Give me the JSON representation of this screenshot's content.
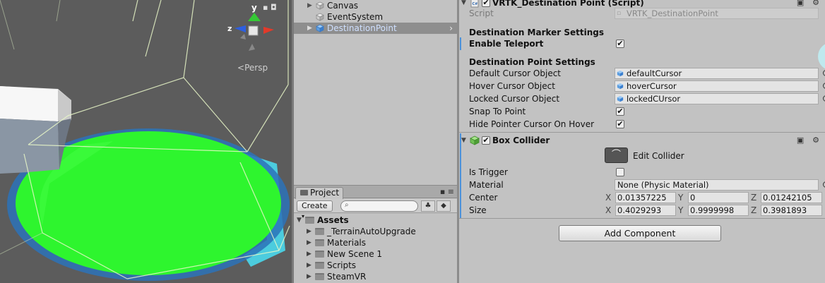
{
  "scene": {
    "persp_label": "Persp",
    "gizmo_y": "y",
    "gizmo_z": "z"
  },
  "hierarchy": {
    "items": [
      {
        "label": "Canvas"
      },
      {
        "label": "EventSystem"
      },
      {
        "label": "DestinationPoint"
      }
    ]
  },
  "project": {
    "tab_label": "Project",
    "create_label": "Create",
    "root": "Assets",
    "folders": [
      "_TerrainAutoUpgrade",
      "Materials",
      "New Scene 1",
      "Scripts",
      "SteamVR"
    ]
  },
  "inspector": {
    "script_component": {
      "title": "VRTK_Destination Point (Script)",
      "script_label": "Script",
      "script_value": "VRTK_DestinationPoint",
      "marker_header": "Destination Marker Settings",
      "enable_teleport_label": "Enable Teleport",
      "enable_teleport": "✔",
      "point_header": "Destination Point Settings",
      "default_cursor_label": "Default Cursor Object",
      "default_cursor_value": "defaultCursor",
      "hover_cursor_label": "Hover Cursor Object",
      "hover_cursor_value": "hoverCursor",
      "locked_cursor_label": "Locked Cursor Object",
      "locked_cursor_value": "lockedCUrsor",
      "snap_label": "Snap To Point",
      "snap": "✔",
      "hide_pointer_label": "Hide Pointer Cursor On Hover",
      "hide_pointer": "✔"
    },
    "box_collider": {
      "title": "Box Collider",
      "edit_label": "Edit Collider",
      "is_trigger_label": "Is Trigger",
      "material_label": "Material",
      "material_value": "None (Physic Material)",
      "center_label": "Center",
      "center": {
        "x": "0.01357225",
        "y": "0",
        "z": "0.01242105"
      },
      "size_label": "Size",
      "size": {
        "x": "0.4029293",
        "y": "0.9999998",
        "z": "0.3981893"
      },
      "axis_x": "X",
      "axis_y": "Y",
      "axis_z": "Z"
    },
    "add_component_label": "Add Component"
  },
  "colors": {
    "scene_bg": "#5f5f5f",
    "green_disc": "#2bf52b",
    "selection": "#8e8e8e",
    "teleport_cyan": "#39d9f0"
  }
}
